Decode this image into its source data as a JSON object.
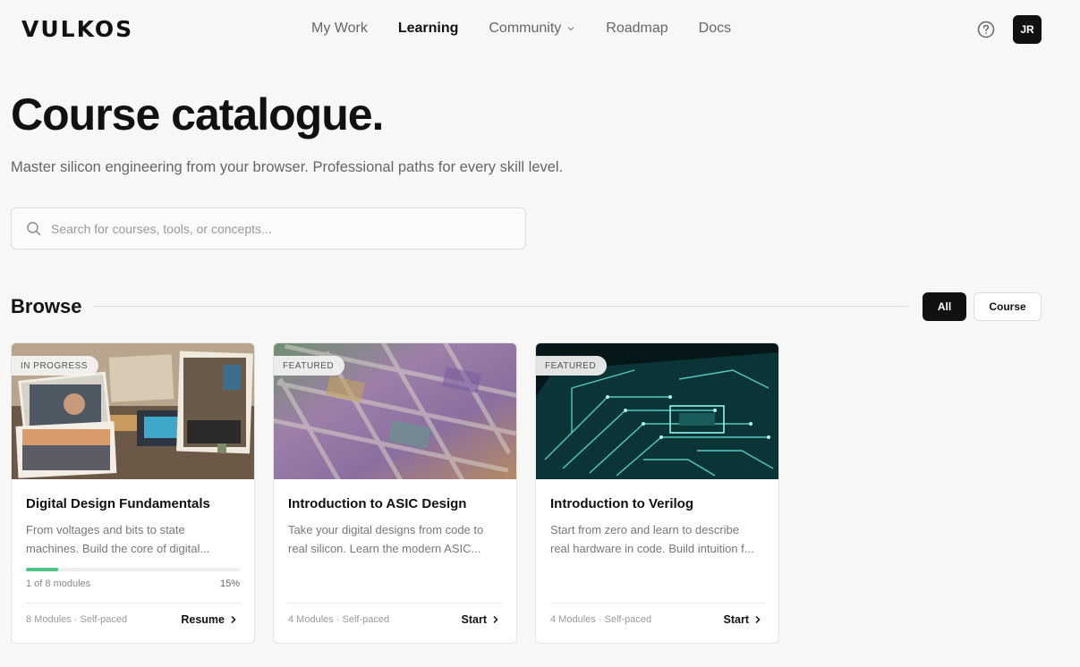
{
  "header": {
    "logo": "VULKOS",
    "nav": [
      {
        "label": "My Work"
      },
      {
        "label": "Learning"
      },
      {
        "label": "Community"
      },
      {
        "label": "Roadmap"
      },
      {
        "label": "Docs"
      }
    ],
    "active_nav": "Learning",
    "help_icon": "question-circle-icon",
    "avatar_initials": "JR"
  },
  "hero": {
    "title": "Course catalogue.",
    "subtitle": "Master silicon engineering from your browser. Professional paths for every skill level."
  },
  "search": {
    "placeholder": "Search for courses, tools, or concepts...",
    "value": ""
  },
  "browse": {
    "title": "Browse",
    "filters": [
      {
        "label": "All",
        "selected": true
      },
      {
        "label": "Course",
        "selected": false
      }
    ]
  },
  "colors": {
    "accent": "#111111",
    "progress": "#4cc486",
    "background": "#f7f7f5"
  },
  "courses": [
    {
      "badge": "IN PROGRESS",
      "title": "Digital Design Fundamentals",
      "desc_line1": "From voltages and bits to state",
      "desc_line2": "machines. Build the core of digital...",
      "progress_label": "1 of 8 modules",
      "progress_pct_label": "15%",
      "progress": 0.15,
      "meta": "8 Modules · Self-paced",
      "action": "Resume"
    },
    {
      "badge": "FEATURED",
      "title": "Introduction to ASIC Design",
      "desc_line1": "Take your digital designs from code to",
      "desc_line2": "real silicon. Learn the modern ASIC...",
      "meta": "4 Modules · Self-paced",
      "action": "Start"
    },
    {
      "badge": "FEATURED",
      "title": "Introduction to Verilog",
      "desc_line1": "Start from zero and learn to describe",
      "desc_line2": "real hardware in code. Build intuition f...",
      "meta": "4 Modules · Self-paced",
      "action": "Start"
    }
  ]
}
